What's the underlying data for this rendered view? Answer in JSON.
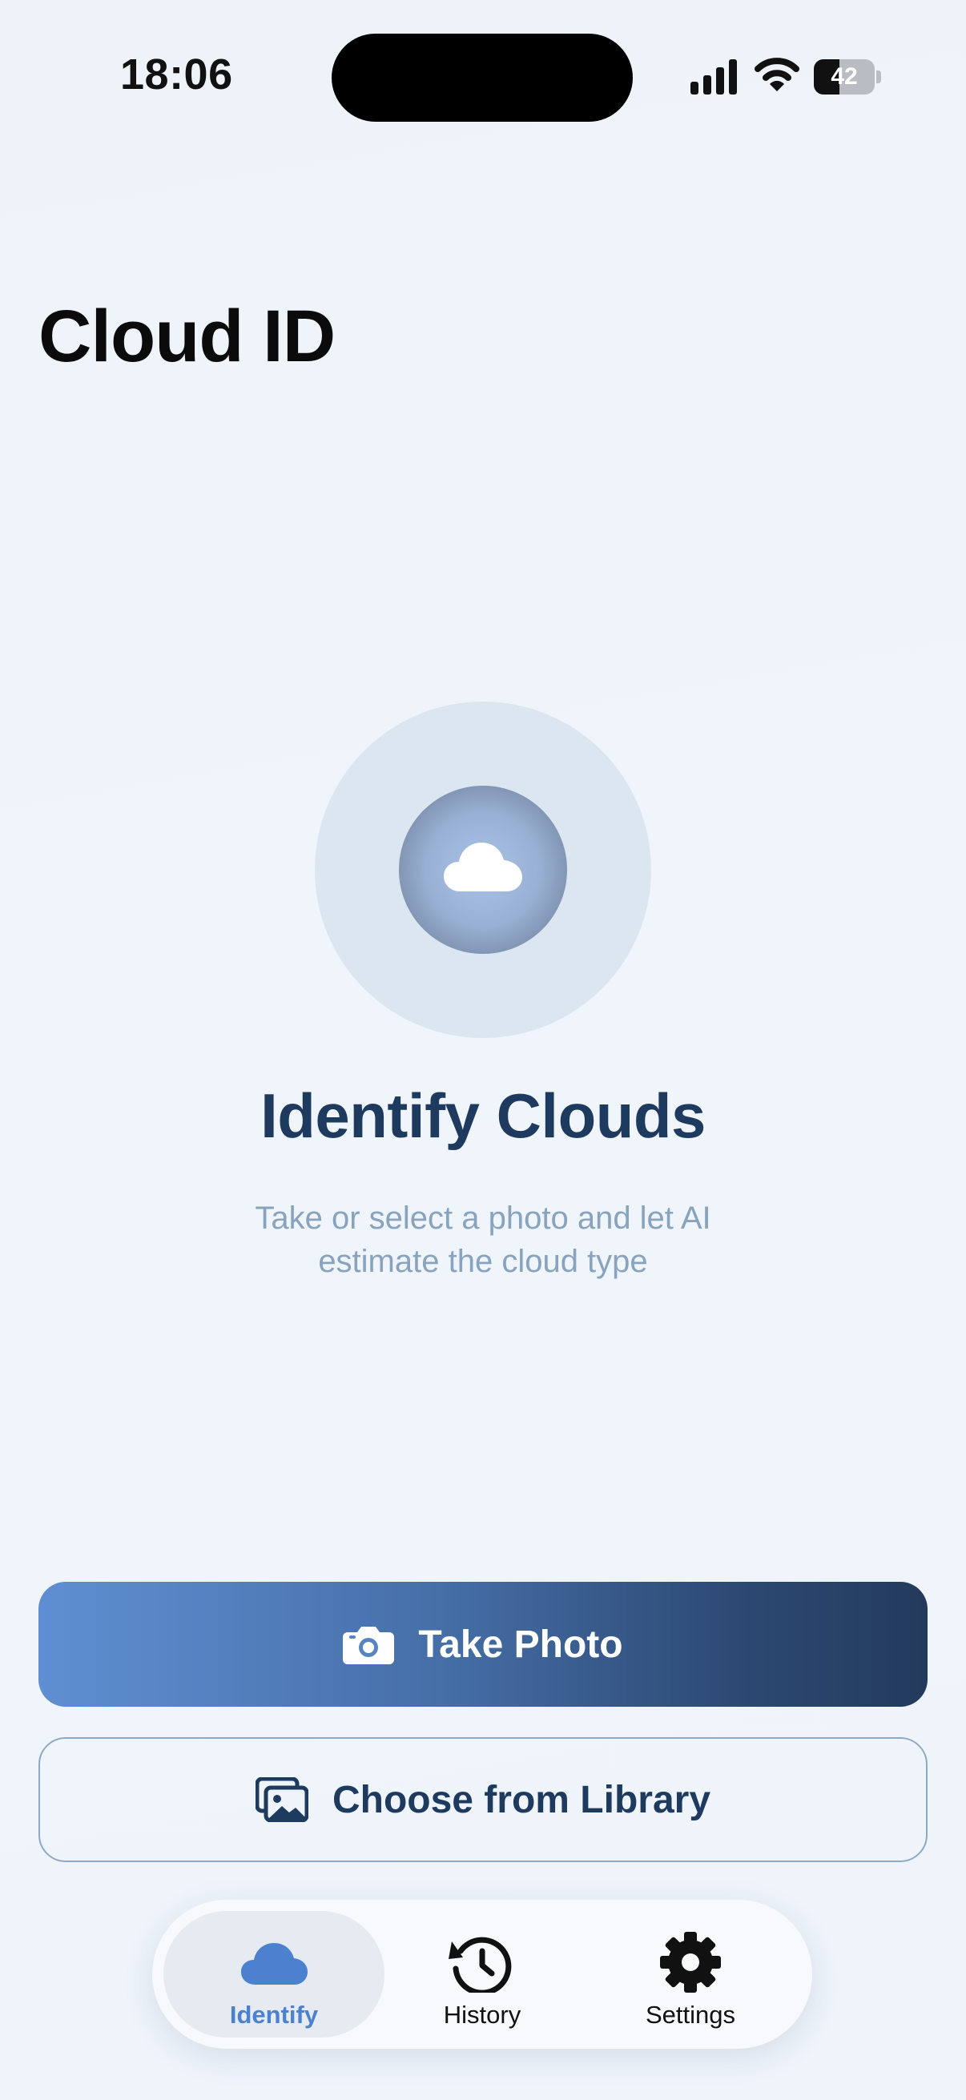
{
  "status_bar": {
    "time": "18:06",
    "battery_level": "42",
    "battery_fraction": 0.42,
    "icons": [
      "signal-icon",
      "wifi-icon",
      "battery-icon"
    ]
  },
  "app": {
    "title": "Cloud ID"
  },
  "hero": {
    "icon": "cloud-icon",
    "title": "Identify Clouds",
    "subtitle": "Take or select a photo and let AI estimate the cloud type"
  },
  "actions": {
    "take_photo": {
      "label": "Take Photo",
      "icon": "camera-icon"
    },
    "choose_library": {
      "label": "Choose from Library",
      "icon": "photo-library-icon"
    }
  },
  "tab_bar": {
    "selected": "Identify",
    "tabs": [
      {
        "label": "Identify",
        "icon": "cloud-icon"
      },
      {
        "label": "History",
        "icon": "history-icon"
      },
      {
        "label": "Settings",
        "icon": "gear-icon"
      }
    ]
  },
  "colors": {
    "accent": "#4c81cf",
    "primary_dark": "#1e3a5f",
    "subtitle": "#87a3bd",
    "background": "#eff4fa"
  }
}
